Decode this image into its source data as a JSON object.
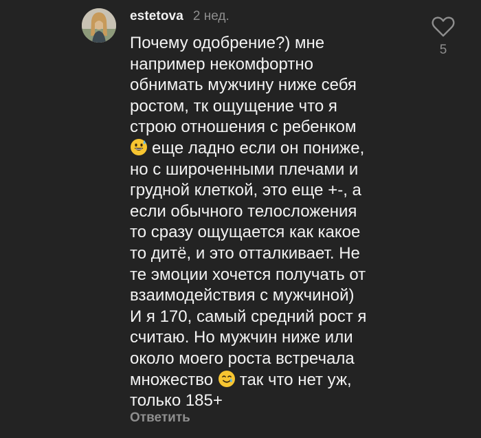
{
  "comment": {
    "username": "estetova",
    "time": "2 нед.",
    "lines": [
      "Почему одобрение?) мне",
      "например некомфортно",
      "обнимать мужчину ниже себя",
      "ростом, тк ощущение что я",
      "строю отношения с ребенком",
      "еще ладно если он пониже,",
      "но с широченными плечами и",
      "грудной клеткой, это еще +-, а",
      "если обычного телосложения",
      "то сразу ощущается как какое",
      "то дитё, и это отталкивает. Не",
      "те эмоции хочется получать от",
      "взаимодействия с мужчиной)",
      "И я 170, самый средний рост я",
      "считаю. Но мужчин ниже или",
      "около моего роста встречала",
      "множество",
      "так что нет уж,",
      "только 185+"
    ],
    "emojis": [
      "grinning-sweat-emoji",
      "smiling-tear-emoji"
    ],
    "reply_label": "Ответить",
    "like_icon": "heart-outline-icon",
    "like_count": "5"
  },
  "colors": {
    "background": "#232323",
    "text": "#f3f3f3",
    "secondary": "#8e8e8e",
    "emoji_yellow": "#f7c531"
  }
}
